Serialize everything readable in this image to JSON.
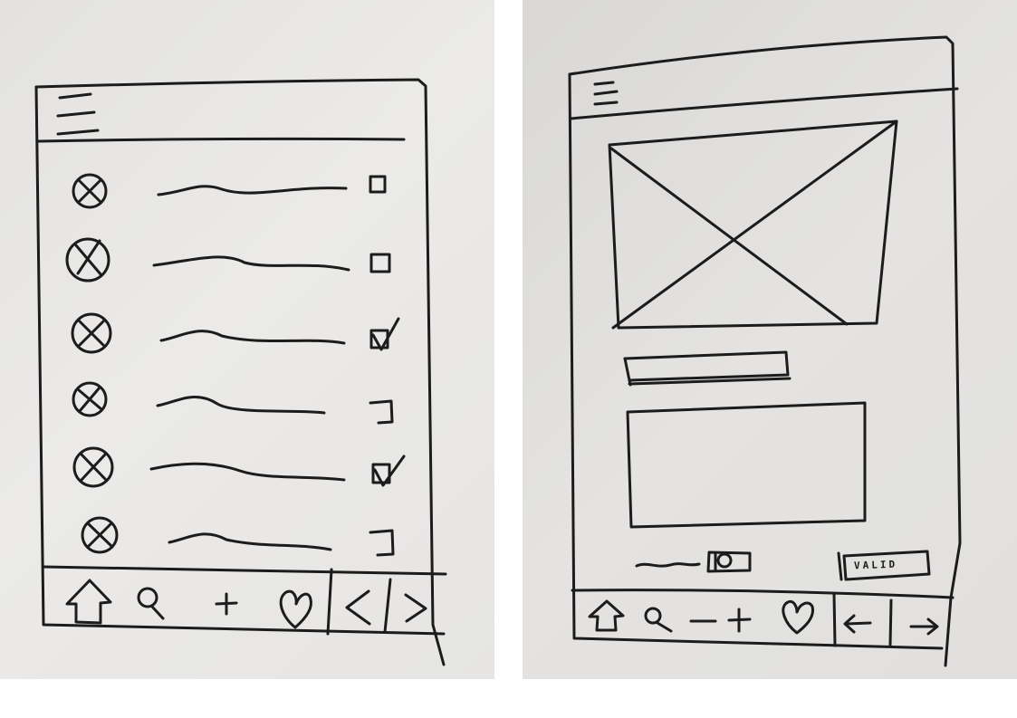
{
  "left_screen": {
    "header": {
      "menu_icon": "hamburger-menu-icon"
    },
    "list": {
      "rows": [
        {
          "icon": "image-placeholder-icon",
          "checked": false
        },
        {
          "icon": "image-placeholder-icon",
          "checked": false
        },
        {
          "icon": "image-placeholder-icon",
          "checked": true
        },
        {
          "icon": "image-placeholder-icon",
          "checked": false
        },
        {
          "icon": "image-placeholder-icon",
          "checked": true
        },
        {
          "icon": "image-placeholder-icon",
          "checked": false
        }
      ]
    },
    "bottom_nav": {
      "items": [
        "home-icon",
        "search-icon",
        "plus-icon",
        "heart-icon",
        "chevron-left-icon",
        "chevron-right-icon"
      ],
      "plus_glyph": "+",
      "prev_glyph": "<",
      "next_glyph": ">"
    }
  },
  "right_screen": {
    "header": {
      "menu_icon": "hamburger-menu-icon"
    },
    "image_placeholder": "image-placeholder-icon",
    "title_field": "text-input",
    "description_field": "textarea",
    "footer": {
      "camera_icon": "camera-icon",
      "valid_label": "VALID"
    },
    "bottom_nav": {
      "items": [
        "home-icon",
        "search-icon",
        "minus-icon",
        "plus-icon",
        "heart-icon",
        "arrow-left-icon",
        "arrow-right-icon"
      ],
      "minus_plus_glyph": "- +",
      "prev_glyph": "←",
      "next_glyph": "→"
    }
  },
  "colors": {
    "ink": "#1c1c1c",
    "paper": "#e6e5e3"
  }
}
